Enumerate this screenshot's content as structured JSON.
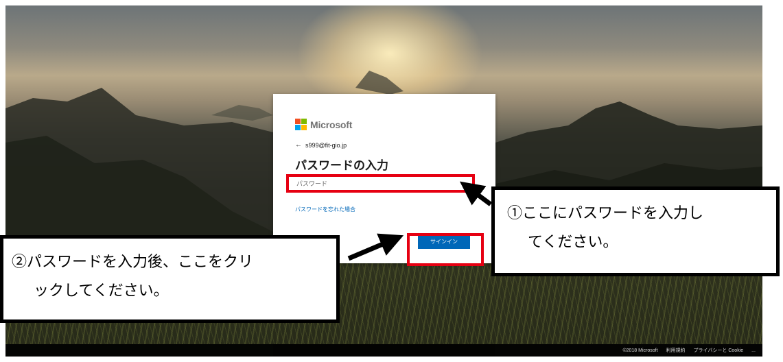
{
  "login_card": {
    "brand": "Microsoft",
    "account_email": "s999@fit-gio.jp",
    "title": "パスワードの入力",
    "password_placeholder": "パスワード",
    "forgot_password_link": "パスワードを忘れた場合",
    "signin_button": "サインイン"
  },
  "footer": {
    "copyright": "©2018 Microsoft",
    "terms": "利用規約",
    "privacy": "プライバシーと Cookie",
    "more": "..."
  },
  "annotations": {
    "step1_line1": "①ここにパスワードを入力し",
    "step1_line2": "てください。",
    "step2_line1": "②パスワードを入力後、ここをクリ",
    "step2_line2": "ックしてください。"
  },
  "colors": {
    "ms_red": "#f25022",
    "ms_green": "#7fba00",
    "ms_blue": "#00a4ef",
    "ms_yellow": "#ffb900",
    "accent_blue": "#0067b8",
    "highlight_red": "#e60012"
  },
  "icons": {
    "back": "left-arrow-icon",
    "logo": "microsoft-logo-icon"
  }
}
